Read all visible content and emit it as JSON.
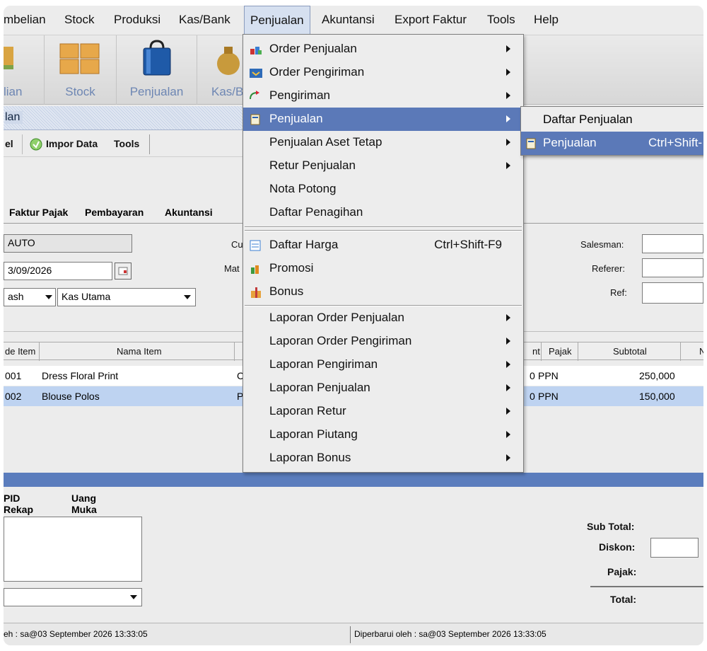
{
  "menubar": [
    "mbelian",
    "Stock",
    "Produksi",
    "Kas/Bank",
    "Penjualan",
    "Akuntansi",
    "Export Faktur",
    "Tools",
    "Help"
  ],
  "toolbar": [
    "lian",
    "Stock",
    "Penjualan",
    "Kas/B"
  ],
  "module_title": "lan",
  "sub_toolbar": {
    "a": "el",
    "b": "Impor Data",
    "c": "Tools"
  },
  "tabs": [
    "Faktur Pajak",
    "Pembayaran",
    "Akuntansi"
  ],
  "form": {
    "no_value": "AUTO",
    "date_value": "3/09/2026",
    "payment": "ash",
    "account": "Kas Utama",
    "cu_label": "Cu",
    "mat_label": "Mat",
    "salesman_label": "Salesman:",
    "referer_label": "Referer:",
    "ref_label": "Ref:"
  },
  "table": {
    "headers": [
      "de Item",
      "Nama Item",
      "nt",
      "Pajak",
      "Subtotal",
      "N"
    ],
    "rows": [
      {
        "code": "001",
        "name": "Dress Floral Print",
        "frag": "C",
        "disc": "0",
        "tax": "PPN",
        "subtotal": "250,000"
      },
      {
        "code": "002",
        "name": "Blouse Polos",
        "frag": "P",
        "disc": "0",
        "tax": "PPN",
        "subtotal": "150,000"
      }
    ]
  },
  "lower_tabs": [
    "PID Rekap",
    "Uang Muka"
  ],
  "totals": {
    "subtotal": "Sub Total:",
    "diskon": "Diskon:",
    "pajak": "Pajak:",
    "total": "Total:"
  },
  "status": {
    "left": "eh : sa@03 September 2026  13:33:05",
    "right": "Diperbarui oleh : sa@03 September 2026  13:33:05"
  },
  "menu": {
    "items": [
      {
        "label": "Order Penjualan",
        "icon": "order-icon",
        "submenu": true
      },
      {
        "label": "Order Pengiriman",
        "icon": "delivery-order-icon",
        "submenu": true
      },
      {
        "label": "Pengiriman",
        "icon": "shipping-icon",
        "submenu": true
      },
      {
        "label": "Penjualan",
        "icon": "invoice-icon",
        "submenu": true,
        "highlighted": true
      },
      {
        "label": "Penjualan Aset Tetap",
        "submenu": true
      },
      {
        "label": "Retur Penjualan",
        "submenu": true
      },
      {
        "label": "Nota Potong"
      },
      {
        "label": "Daftar Penagihan"
      },
      {
        "label": "Daftar Harga",
        "icon": "price-list-icon",
        "shortcut": "Ctrl+Shift-F9"
      },
      {
        "label": "Promosi",
        "icon": "promotion-icon"
      },
      {
        "label": "Bonus",
        "icon": "bonus-icon"
      },
      {
        "label": "Laporan Order Penjualan",
        "submenu": true
      },
      {
        "label": "Laporan Order Pengiriman",
        "submenu": true
      },
      {
        "label": "Laporan Pengiriman",
        "submenu": true
      },
      {
        "label": "Laporan Penjualan",
        "submenu": true
      },
      {
        "label": "Laporan Retur",
        "submenu": true
      },
      {
        "label": "Laporan Piutang",
        "submenu": true
      },
      {
        "label": "Laporan Bonus",
        "submenu": true
      }
    ]
  },
  "submenu": {
    "items": [
      {
        "label": "Daftar Penjualan"
      },
      {
        "label": "Penjualan",
        "shortcut": "Ctrl+Shift-",
        "highlighted": true
      }
    ]
  },
  "colors": {
    "menu_highlight": "#5b79b8",
    "divider": "#5b7dbd"
  }
}
